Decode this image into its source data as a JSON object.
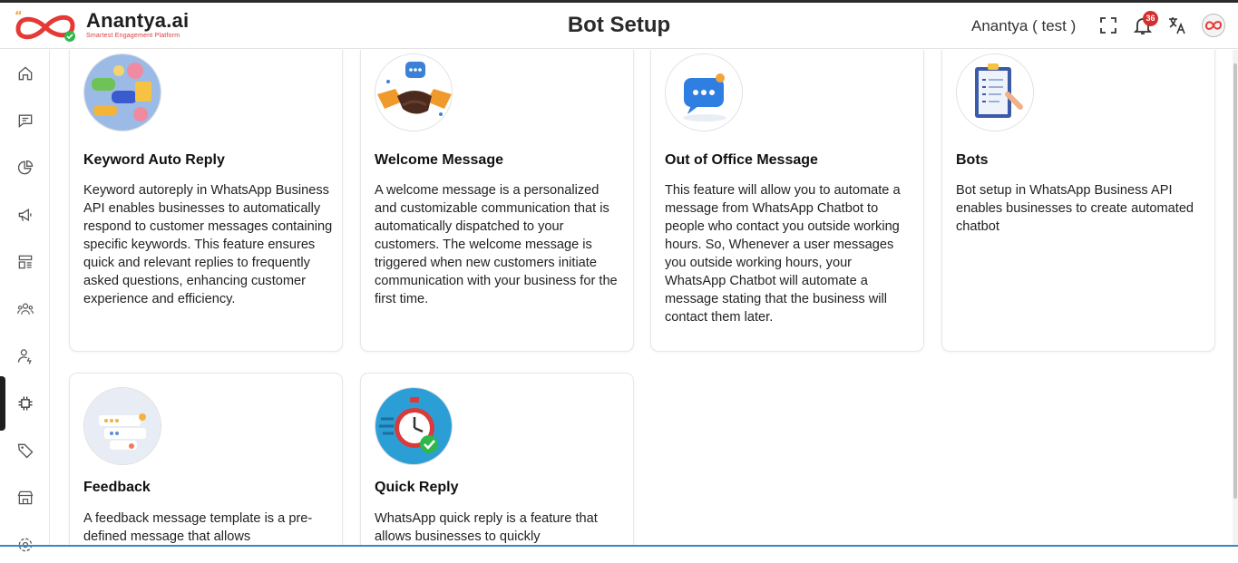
{
  "header": {
    "brand_name": "Anantya.ai",
    "brand_tagline": "Smartest Engagement Platform",
    "page_title": "Bot Setup",
    "user_label": "Anantya ( test )",
    "notification_count": "36",
    "icons": [
      "fullscreen-icon",
      "bell-icon",
      "translate-icon",
      "avatar"
    ]
  },
  "sidebar": {
    "items": [
      {
        "icon": "home-icon"
      },
      {
        "icon": "chat-icon"
      },
      {
        "icon": "analytics-icon"
      },
      {
        "icon": "campaign-icon"
      },
      {
        "icon": "templates-icon"
      },
      {
        "icon": "contacts-icon"
      },
      {
        "icon": "agents-icon"
      },
      {
        "icon": "bot-setup-icon",
        "active": true
      },
      {
        "icon": "tag-icon"
      },
      {
        "icon": "store-icon"
      },
      {
        "icon": "settings-icon"
      }
    ]
  },
  "cards": [
    {
      "title": "Keyword Auto Reply",
      "description": "Keyword autoreply in WhatsApp Business API enables businesses to automatically respond to customer messages containing specific keywords. This feature ensures quick and relevant replies to frequently asked questions, enhancing customer experience and efficiency."
    },
    {
      "title": "Welcome Message",
      "description": "A welcome message is a personalized and customizable communication that is automatically dispatched to your customers. The welcome message is triggered when new customers initiate communication with your business for the first time."
    },
    {
      "title": "Out of Office Message",
      "description": "This feature will allow you to automate a message from WhatsApp Chatbot to people who contact you outside working hours. So, Whenever a user messages you outside working hours, your WhatsApp Chatbot will automate a message stating that the business will contact them later."
    },
    {
      "title": "Bots",
      "description": "Bot setup in WhatsApp Business API enables businesses to create automated chatbot"
    },
    {
      "title": "Feedback",
      "description": "A feedback message template is a pre-defined message that allows"
    },
    {
      "title": "Quick Reply",
      "description": "WhatsApp quick reply is a feature that allows businesses to quickly"
    }
  ],
  "colors": {
    "brand_red": "#e53935",
    "badge_red": "#d32f2f",
    "bottom_accent": "#3a86c8"
  }
}
